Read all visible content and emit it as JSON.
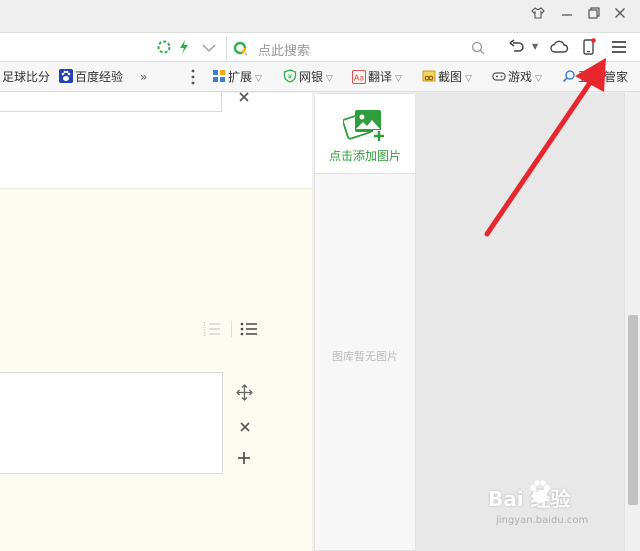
{
  "window": {
    "controls": [
      "skin-icon",
      "minimize-icon",
      "restore-icon",
      "close-icon"
    ]
  },
  "addressbar": {
    "search_placeholder": "点此搜索"
  },
  "bookmarks": {
    "items": [
      {
        "label": "足球比分",
        "has_caret": false
      },
      {
        "label": "百度经验",
        "has_caret": false
      },
      {
        "label": "»",
        "has_caret": false
      },
      {
        "label": "扩展",
        "has_caret": true
      },
      {
        "label": "网银",
        "has_caret": true
      },
      {
        "label": "翻译",
        "has_caret": true
      },
      {
        "label": "截图",
        "has_caret": true
      },
      {
        "label": "游戏",
        "has_caret": true
      },
      {
        "label": "登",
        "has_caret": false
      },
      {
        "label": "管家",
        "has_caret": false
      }
    ],
    "more_icon": "vertical-dots-icon"
  },
  "editor": {
    "controls": [
      "move-icon",
      "delete-icon",
      "add-icon"
    ],
    "list_icons": [
      "ordered-list-icon",
      "unordered-list-icon"
    ]
  },
  "gallery": {
    "add_label": "点击添加图片",
    "empty_label": "图库暂无图片"
  },
  "watermark": {
    "main": "Bai  经验",
    "sub": "jingyan.baidu.com"
  },
  "colors": {
    "accent_green": "#2f9e3d",
    "annotation_red": "#e8262d",
    "editor_yellow": "#fdfcf0"
  }
}
